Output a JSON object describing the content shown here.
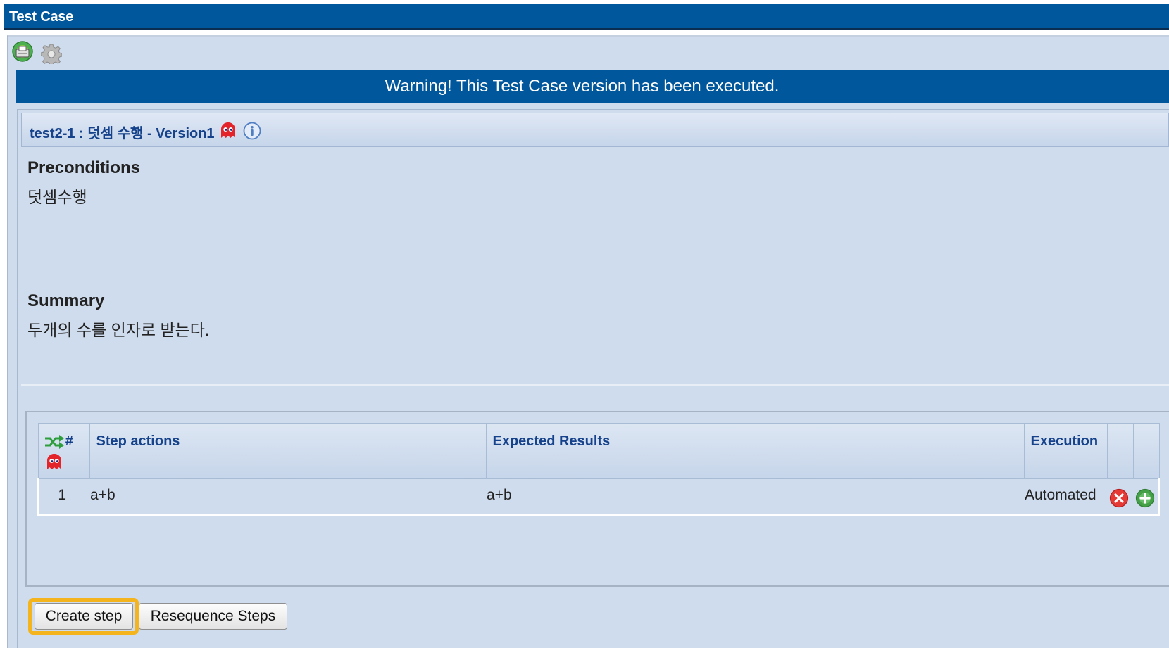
{
  "window": {
    "title": "Test Case"
  },
  "toolbar": {
    "icons": [
      "export-icon",
      "gear-icon"
    ]
  },
  "warning": {
    "text": "Warning! This Test Case version has been executed."
  },
  "test_case": {
    "title": "test2-1 : 덧셈 수행 - Version1",
    "preconditions_heading": "Preconditions",
    "preconditions_text": "덧셈수행",
    "summary_heading": "Summary",
    "summary_text": "두개의 수를 인자로 받는다."
  },
  "steps_table": {
    "columns": {
      "number": "#",
      "actions": "Step actions",
      "expected": "Expected Results",
      "execution": "Execution"
    },
    "rows": [
      {
        "number": "1",
        "action": "a+b",
        "expected": "a+b",
        "execution": "Automated"
      }
    ]
  },
  "buttons": {
    "create_step": "Create step",
    "resequence": "Resequence Steps"
  },
  "colors": {
    "title_bar": "#01579b",
    "panel_background": "#cfdcee",
    "header_text": "#15428b",
    "focus_ring": "#f3b41d",
    "delete_icon": "#e53935",
    "add_icon": "#43a047"
  }
}
